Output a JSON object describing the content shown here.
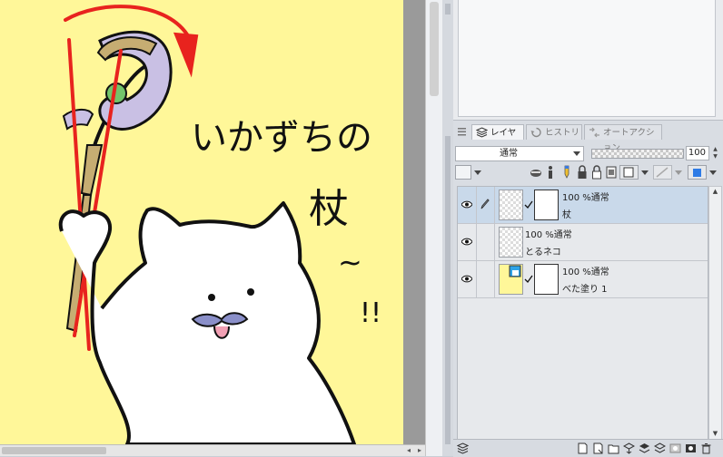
{
  "artwork": {
    "text_line1": "いかずちの",
    "text_line2": "杖",
    "text_tail": "~",
    "exclaim": "!!",
    "bg_color": "#fff799"
  },
  "palette": {
    "tabs": [
      {
        "label": "レイヤー",
        "icon": "layer-stack-icon",
        "active": true
      },
      {
        "label": "ヒストリー",
        "icon": "history-icon",
        "active": false
      },
      {
        "label": "オートアクション",
        "icon": "auto-action-icon",
        "active": false
      }
    ],
    "blend_mode": "通常",
    "opacity": "100",
    "layers": [
      {
        "percent_mode": "100 %通常",
        "name": "杖",
        "selected": true
      },
      {
        "percent_mode": "100 %通常",
        "name": "とるネコ",
        "selected": false
      },
      {
        "percent_mode": "100 %通常",
        "name": "べた塗り 1",
        "selected": false
      }
    ]
  },
  "colors": {
    "canvas_bg": "#fff799",
    "selected_layer": "#c9d9ea",
    "accent_red": "#e8231e"
  }
}
